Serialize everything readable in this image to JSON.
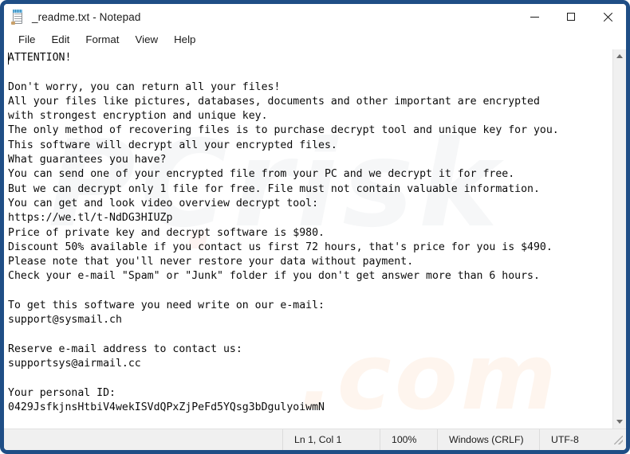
{
  "window": {
    "title": "_readme.txt - Notepad",
    "icon": "notepad-icon",
    "accent_border": "#1f4e86",
    "controls": {
      "minimize": "–",
      "maximize": "□",
      "close": "×"
    }
  },
  "menubar": {
    "items": [
      {
        "label": "File"
      },
      {
        "label": "Edit"
      },
      {
        "label": "Format"
      },
      {
        "label": "View"
      },
      {
        "label": "Help"
      }
    ]
  },
  "editor": {
    "lines": [
      "ATTENTION!",
      "",
      "Don't worry, you can return all your files!",
      "All your files like pictures, databases, documents and other important are encrypted",
      "with strongest encryption and unique key.",
      "The only method of recovering files is to purchase decrypt tool and unique key for you.",
      "This software will decrypt all your encrypted files.",
      "What guarantees you have?",
      "You can send one of your encrypted file from your PC and we decrypt it for free.",
      "But we can decrypt only 1 file for free. File must not contain valuable information.",
      "You can get and look video overview decrypt tool:",
      "https://we.tl/t-NdDG3HIUZp",
      "Price of private key and decrypt software is $980.",
      "Discount 50% available if you contact us first 72 hours, that's price for you is $490.",
      "Please note that you'll never restore your data without payment.",
      "Check your e-mail \"Spam\" or \"Junk\" folder if you don't get answer more than 6 hours.",
      "",
      "To get this software you need write on our e-mail:",
      "support@sysmail.ch",
      "",
      "Reserve e-mail address to contact us:",
      "supportsys@airmail.cc",
      "",
      "Your personal ID:",
      "0429JsfkjnsHtbiV4wekISVdQPxZjPeFd5YQsg3bDgulyoiwmN"
    ],
    "watermark": {
      "brand": "PCrisk",
      "suffix": ".com",
      "dot": "."
    }
  },
  "scrollbar": {
    "up_icon": "triangle-up-icon",
    "down_icon": "triangle-down-icon"
  },
  "statusbar": {
    "line_col": "Ln 1, Col 1",
    "zoom": "100%",
    "line_ending": "Windows (CRLF)",
    "encoding": "UTF-8"
  }
}
